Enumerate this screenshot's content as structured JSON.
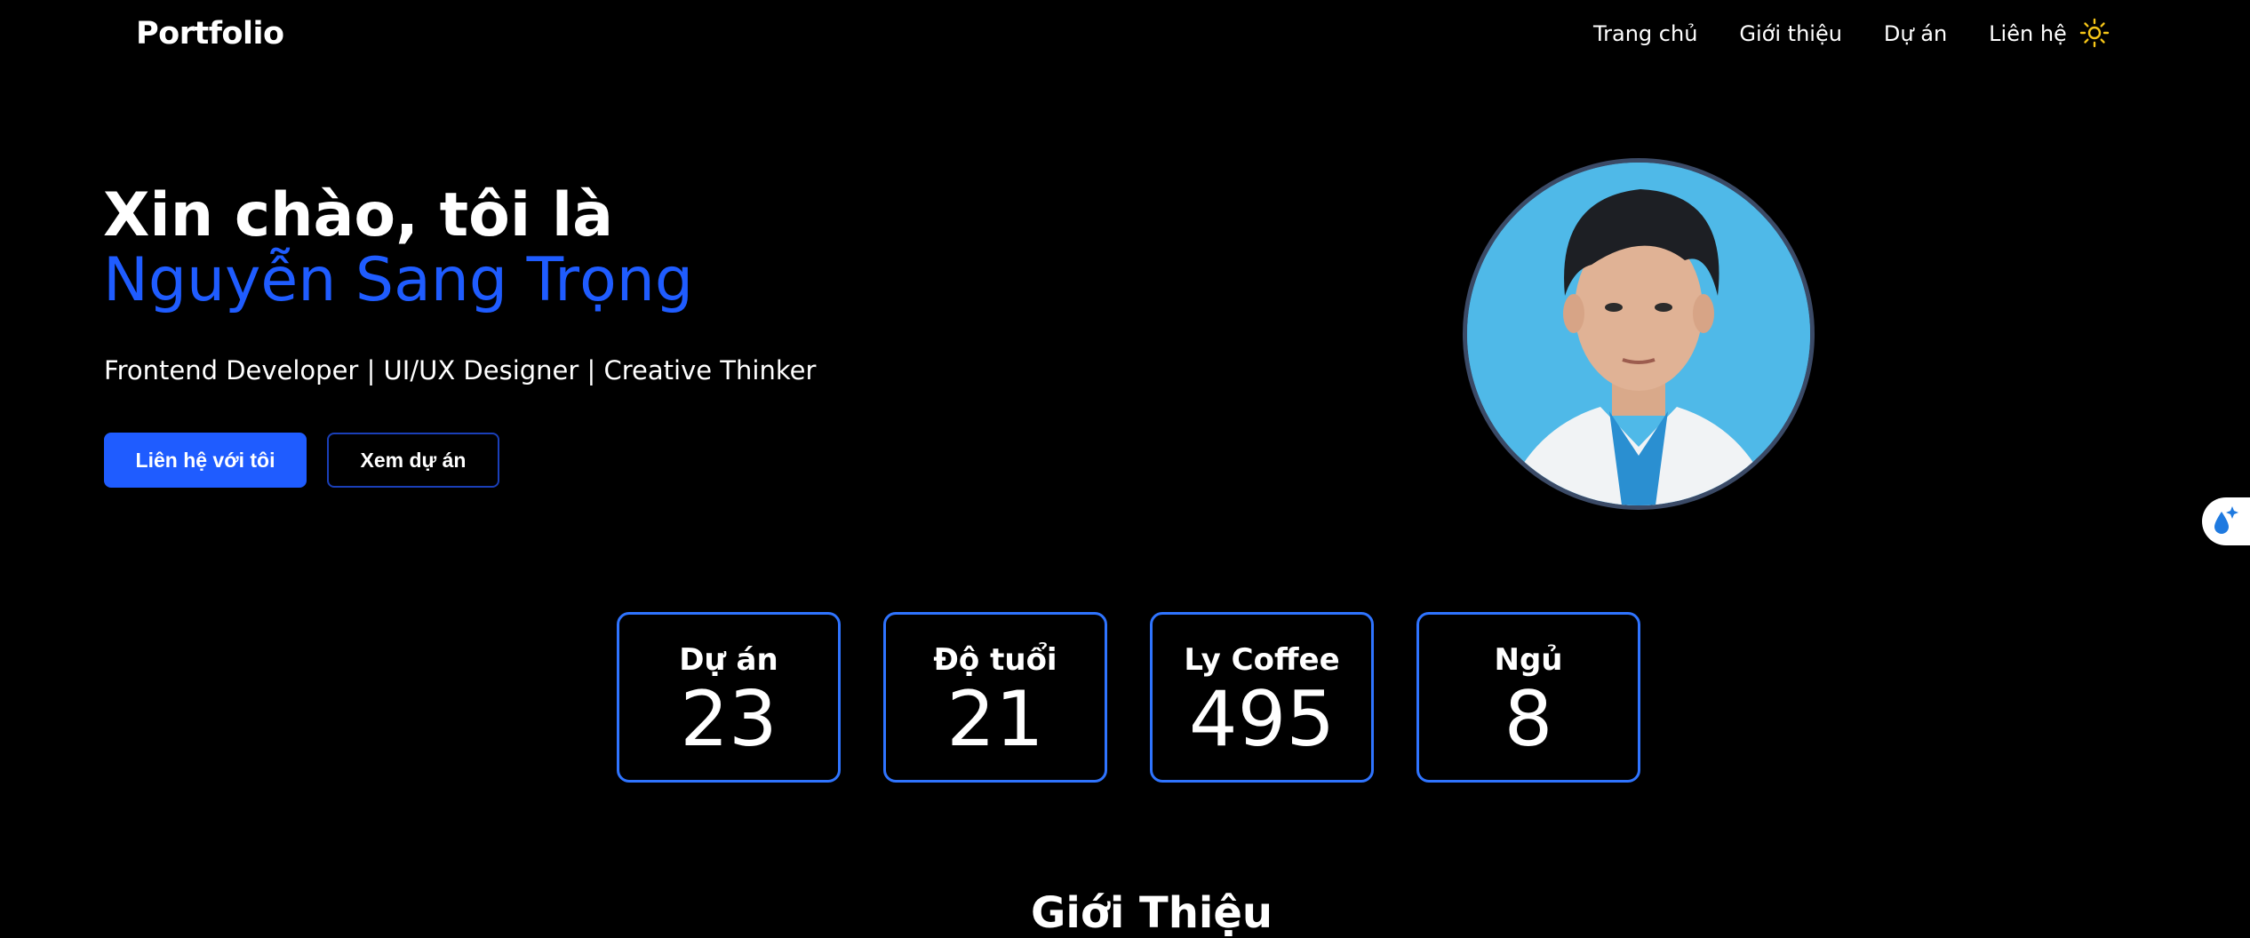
{
  "navbar": {
    "brand": "Portfolio",
    "links": [
      "Trang chủ",
      "Giới thiệu",
      "Dự án",
      "Liên hệ"
    ],
    "theme_icon": "sun-icon"
  },
  "hero": {
    "greeting": "Xin chào, tôi là",
    "name": "Nguyễn Sang Trọng",
    "subtitle": "Frontend Developer | UI/UX Designer | Creative Thinker",
    "primary_button": "Liên hệ với tôi",
    "secondary_button": "Xem dự án",
    "accent_color": "#1f5cff"
  },
  "stats": [
    {
      "label": "Dự án",
      "value": "23"
    },
    {
      "label": "Độ tuổi",
      "value": "21"
    },
    {
      "label": "Ly Coffee",
      "value": "495"
    },
    {
      "label": "Ngủ",
      "value": "8"
    }
  ],
  "about": {
    "title": "Giới Thiệu"
  },
  "side_widget": {
    "icon": "water-drop-sparkle-icon"
  }
}
